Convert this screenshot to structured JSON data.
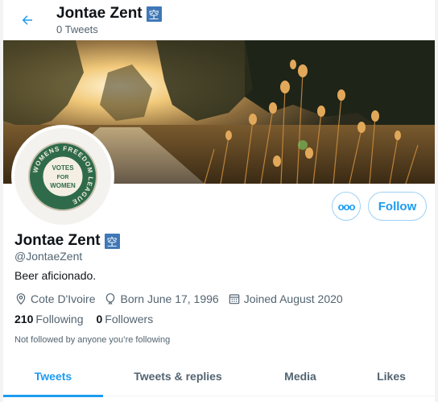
{
  "header": {
    "name": "Jontae Zent",
    "badge": "空",
    "tweet_count": "0 Tweets"
  },
  "profile": {
    "name": "Jontae Zent",
    "badge": "空",
    "handle": "@JontaeZent",
    "bio": "Beer aficionado.",
    "location": "Cote D'Ivoire",
    "birthday": "Born June 17, 1996",
    "joined": "Joined August 2020",
    "following_count": "210",
    "following_label": "Following",
    "followers_count": "0",
    "followers_label": "Followers",
    "followed_note": "Not followed by anyone you’re following"
  },
  "avatar": {
    "ring_text": "WOMENS FREEDOM LEAGUE",
    "center_lines": [
      "VOTES",
      "FOR",
      "WOMEN"
    ]
  },
  "actions": {
    "more_label": "ooo",
    "follow_label": "Follow"
  },
  "tabs": [
    {
      "label": "Tweets",
      "active": true
    },
    {
      "label": "Tweets & replies",
      "active": false
    },
    {
      "label": "Media",
      "active": false
    },
    {
      "label": "Likes",
      "active": false
    }
  ],
  "colors": {
    "accent": "#1d9bf0",
    "badge": "#3f78b6",
    "text": "#0f1419",
    "muted": "#536471"
  },
  "icons": {
    "back": "arrow-left-icon",
    "location": "location-pin-icon",
    "birthday": "balloon-icon",
    "joined": "calendar-icon"
  }
}
